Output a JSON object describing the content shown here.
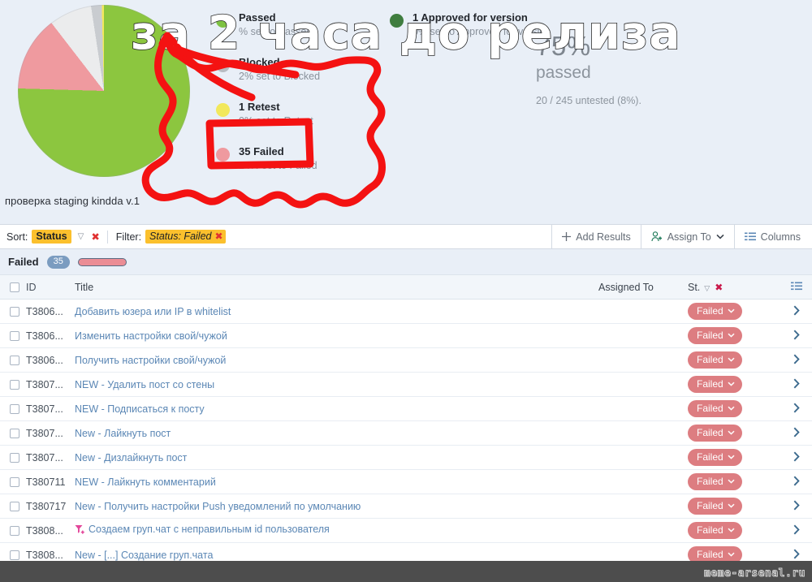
{
  "summary": {
    "caption": "проверка staging kindda v.1",
    "legend_left": [
      {
        "title": "Passed",
        "sub": "% set to Passed",
        "color": "#8cc63f",
        "dot": "#7ec242"
      },
      {
        "title": "Blocked",
        "sub": "2% set to Blocked",
        "color": "#b7bcc2",
        "dot": "#b7bcc2"
      },
      {
        "title": "1 Retest",
        "sub": "0% set to Retest",
        "color": "#f2e85c",
        "dot": "#f2e85c"
      },
      {
        "title": "35 Failed",
        "sub": "14% set to Failed",
        "color": "#ef9a9f",
        "dot": "#ef9a9f"
      }
    ],
    "legend_right": [
      {
        "title": "1 Approved for version",
        "sub": "0% set to Approved for version",
        "color": "#3f7d3f",
        "dot": "#3f7d3f"
      }
    ],
    "big_percent": "75%",
    "big_label": "passed",
    "untested": "20 / 245 untested (8%).",
    "colors": {
      "panel_bg": "#e9eff7",
      "passed": "#8cc63f",
      "failed": "#ef9a9f",
      "untested": "#ebeced",
      "blocked": "#c9ccd0",
      "retest": "#f2e85c"
    }
  },
  "chart_data": {
    "type": "pie",
    "title": "проверка staging kindda v.1",
    "labels": [
      "Passed",
      "Failed",
      "Untested",
      "Blocked",
      "Retest"
    ],
    "values": [
      75,
      14,
      8,
      2,
      0.4
    ],
    "colors": [
      "#8cc63f",
      "#ef9a9f",
      "#ebeced",
      "#c9ccd0",
      "#f2e85c"
    ],
    "total_tests": 245,
    "units": "percent",
    "legend_position": "right",
    "annotations": [
      "75% passed",
      "20 / 245 untested (8%)."
    ]
  },
  "toolbar": {
    "sort_label": "Sort:",
    "sort_value": "Status",
    "filter_label": "Filter:",
    "filter_value": "Status: Failed",
    "clear_x": "✖",
    "sort_arrow": "▽",
    "add_results": "Add Results",
    "assign_to": "Assign To",
    "columns": "Columns"
  },
  "group": {
    "name": "Failed",
    "count": "35"
  },
  "table": {
    "headers": {
      "id": "ID",
      "title": "Title",
      "assigned_to": "Assigned To",
      "status": "St.",
      "sort_arrow": "▽",
      "clear_x": "✖"
    },
    "rows": [
      {
        "id": "T3806...",
        "title": "Добавить юзера или IP в whitelist",
        "assigned_to": "",
        "status": "Failed",
        "icon": ""
      },
      {
        "id": "T3806...",
        "title": "Изменить настройки свой/чужой",
        "assigned_to": "",
        "status": "Failed",
        "icon": ""
      },
      {
        "id": "T3806...",
        "title": "Получить настройки свой/чужой",
        "assigned_to": "",
        "status": "Failed",
        "icon": ""
      },
      {
        "id": "T3807...",
        "title": "NEW - Удалить пост со стены",
        "assigned_to": "",
        "status": "Failed",
        "icon": ""
      },
      {
        "id": "T3807...",
        "title": "NEW - Подписаться к посту",
        "assigned_to": "",
        "status": "Failed",
        "icon": ""
      },
      {
        "id": "T3807...",
        "title": "New - Лайкнуть пост",
        "assigned_to": "",
        "status": "Failed",
        "icon": ""
      },
      {
        "id": "T3807...",
        "title": "New - Дизлайкнуть пост",
        "assigned_to": "",
        "status": "Failed",
        "icon": ""
      },
      {
        "id": "T380711",
        "title": "NEW - Лайкнуть комментарий",
        "assigned_to": "",
        "status": "Failed",
        "icon": ""
      },
      {
        "id": "T380717",
        "title": "New - Получить настройки Push уведомлений по умолчанию",
        "assigned_to": "",
        "status": "Failed",
        "icon": ""
      },
      {
        "id": "T3808...",
        "title": "Создаем груп.чат с неправильным id пользователя",
        "assigned_to": "",
        "status": "Failed",
        "icon": "filter-plus-icon"
      },
      {
        "id": "T3808...",
        "title": "New - [...] Создание груп.чата",
        "assigned_to": "",
        "status": "Failed",
        "icon": ""
      }
    ],
    "row_chevron": "›",
    "status_chevron": "⌄"
  },
  "overlay": {
    "meme_text": "за 2 часа до релиза",
    "watermark": "meme-arsenal.ru"
  }
}
